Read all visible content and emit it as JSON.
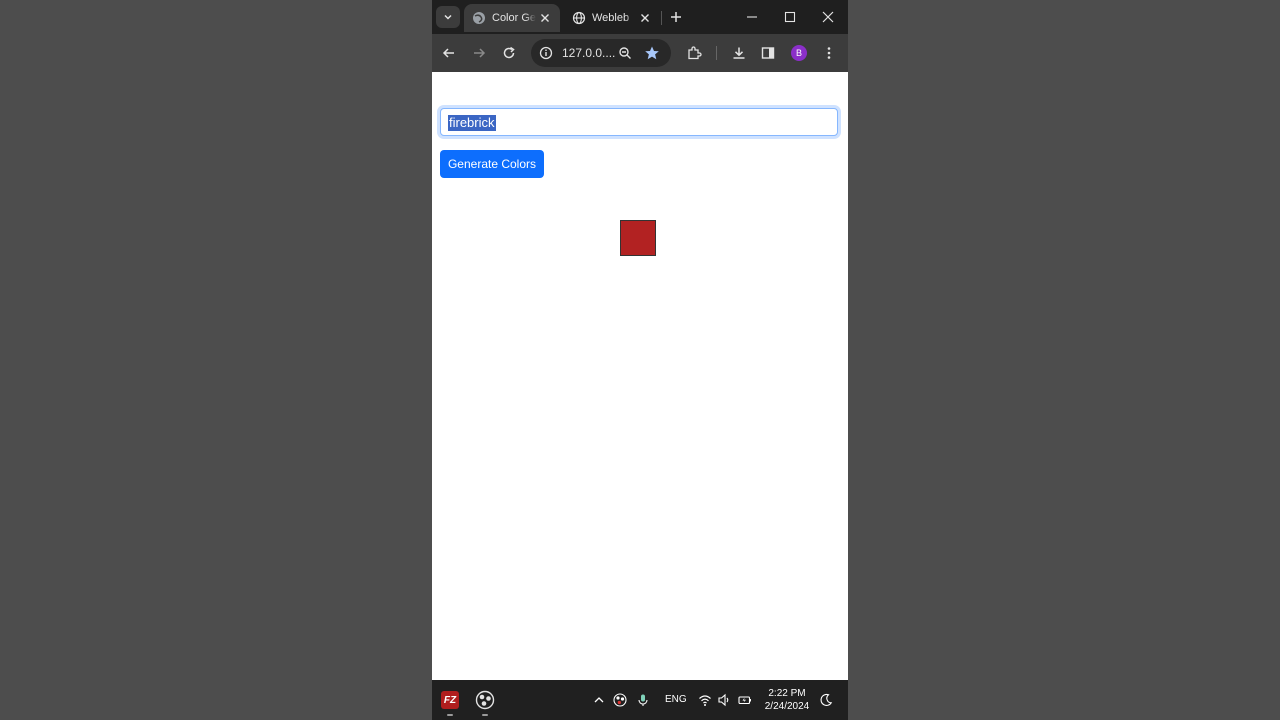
{
  "browser": {
    "tabs": [
      {
        "title": "Color Ge",
        "active": true
      },
      {
        "title": "Webleb",
        "active": false
      }
    ],
    "address": "127.0.0....",
    "profile_initial": "B",
    "profile_color": "#8b2fc9"
  },
  "page": {
    "input_value": "firebrick",
    "button_label": "Generate Colors",
    "button_color": "#0d6efd",
    "swatches": [
      {
        "color": "#b22222"
      }
    ]
  },
  "taskbar": {
    "language": "ENG",
    "time": "2:22 PM",
    "date": "2/24/2024"
  }
}
